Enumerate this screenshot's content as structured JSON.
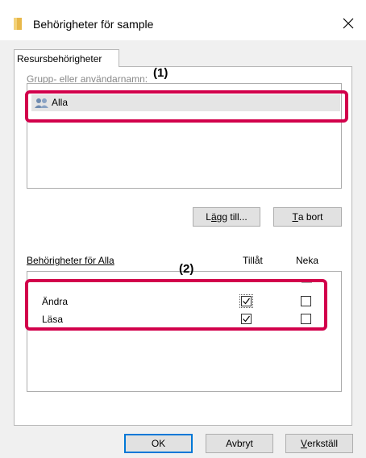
{
  "window": {
    "title": "Behörigheter för sample",
    "close_glyph": "✕",
    "folder_icon": "folder-icon",
    "accent": "#0078d7"
  },
  "tabs": [
    {
      "label": "Resursbehörigheter"
    }
  ],
  "groups": {
    "label": "Grupp- eller användarnamn:",
    "items": [
      {
        "label": "Alla",
        "icon": "users-icon",
        "selected": true
      }
    ],
    "add_button": {
      "prefix": "L",
      "mnemonic": "ä",
      "suffix": "gg till..."
    },
    "remove_button": {
      "mnemonic": "T",
      "suffix": "a bort"
    }
  },
  "permissions": {
    "title": "Behörigheter för Alla",
    "col_allow": "Tillåt",
    "col_deny": "Neka",
    "rows": [
      {
        "label": "Ändra",
        "allow": true,
        "deny": false
      },
      {
        "label": "Läsa",
        "allow": true,
        "deny": false
      }
    ]
  },
  "footer": {
    "ok_label": "OK",
    "cancel_label": "Avbryt",
    "apply": {
      "mnemonic": "V",
      "suffix": "erkställ"
    }
  },
  "annotations": {
    "callout_1": "(1)",
    "callout_2": "(2)",
    "color": "#d2004b"
  }
}
